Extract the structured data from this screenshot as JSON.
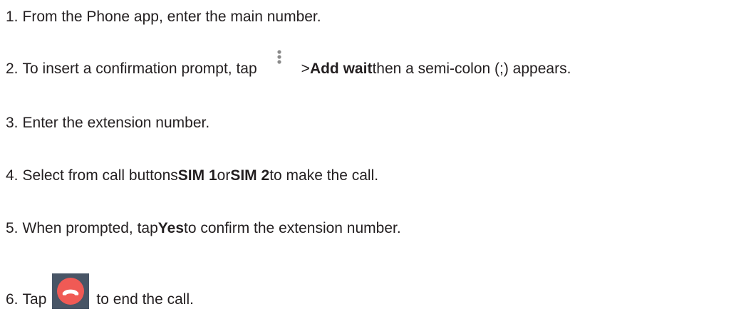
{
  "steps": [
    {
      "number": "1.",
      "text": "From the Phone app, enter the main number."
    },
    {
      "number": "2.",
      "before_icon": "To insert a confirmation prompt, tap",
      "icon": "more-options-icon",
      "after_icon_prefix": "> ",
      "bold": "Add wait",
      "after_bold": " then a semi-colon (;) appears."
    },
    {
      "number": "3.",
      "text": "Enter the extension number."
    },
    {
      "number": "4.",
      "prefix": "Select from call buttons ",
      "bold1": "SIM 1",
      "middle": " or ",
      "bold2": "SIM 2",
      "suffix": " to make the call."
    },
    {
      "number": "5.",
      "prefix": "When prompted, tap ",
      "bold": "Yes",
      "suffix": " to confirm the extension number."
    },
    {
      "number": "6.",
      "before_icon": "Tap",
      "icon": "end-call-icon",
      "after_icon": "to end the call."
    }
  ],
  "colors": {
    "text": "#231f20",
    "more_icon_dots": "#8a8a8a",
    "end_call_background": "#485566",
    "end_call_circle": "#f05a55",
    "end_call_handset": "#ffffff"
  }
}
